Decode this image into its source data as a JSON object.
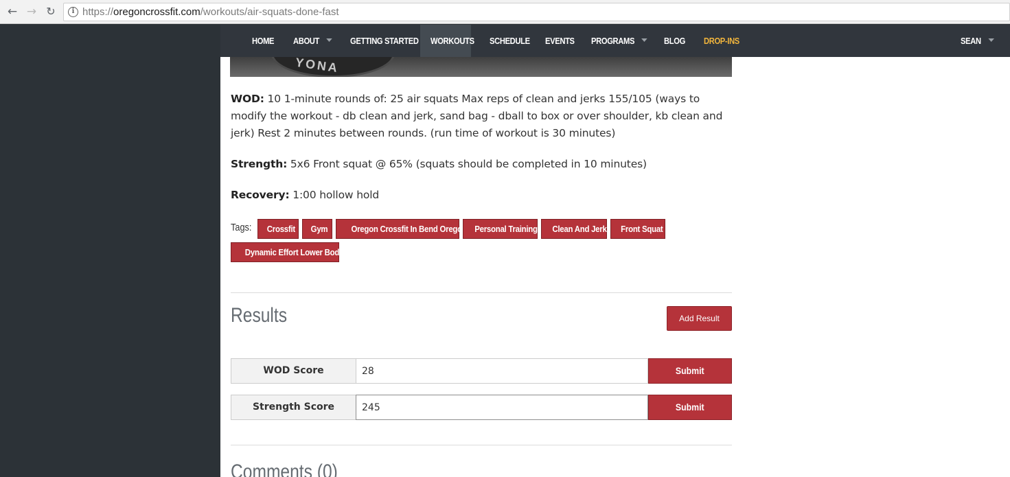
{
  "browser": {
    "url_prefix": "https://",
    "url_domain": "oregoncrossfit.com",
    "url_path": "/workouts/air-squats-done-fast"
  },
  "nav": {
    "items": [
      {
        "label": "HOME"
      },
      {
        "label": "ABOUT",
        "has_dropdown": true
      },
      {
        "label": "GETTING STARTED"
      },
      {
        "label": "WORKOUTS",
        "active": true
      },
      {
        "label": "SCHEDULE"
      },
      {
        "label": "EVENTS"
      },
      {
        "label": "PROGRAMS",
        "has_dropdown": true
      },
      {
        "label": "BLOG"
      },
      {
        "label": "DROP-INS",
        "color": "#f0b43c"
      }
    ],
    "user": {
      "label": "SEAN",
      "has_dropdown": true
    }
  },
  "hero": {
    "plate_text": "YONA"
  },
  "workout": {
    "wod_label": "WOD:",
    "wod_text": " 10 1-minute rounds of: 25 air squats Max reps of clean and jerks 155/105 (ways to modify the workout - db clean and jerk, sand bag - dball to box or over shoulder, kb clean and jerk) Rest 2 minutes between rounds. (run time of workout is 30 minutes)",
    "strength_label": "Strength:",
    "strength_text": " 5x6 Front squat @ 65% (squats should be completed in 10 minutes)",
    "recovery_label": "Recovery:",
    "recovery_text": " 1:00 hollow hold"
  },
  "tags": {
    "label": "Tags:",
    "items": [
      "Crossfit",
      "Gym",
      "Oregon Crossfit In Bend Oregon",
      "Personal Training",
      "Clean And Jerk",
      "Front Squat",
      "Dynamic Effort Lower Body"
    ]
  },
  "results": {
    "heading": "Results",
    "add_button": "Add Result",
    "wod_score_label": "WOD Score",
    "wod_score_value": "28",
    "strength_score_label": "Strength Score",
    "strength_score_value": "245",
    "submit_label": "Submit"
  },
  "comments": {
    "heading": "Comments (0)"
  },
  "colors": {
    "accent": "#b5333a",
    "nav_bg": "#31363d",
    "page_bg": "#2c3237"
  }
}
